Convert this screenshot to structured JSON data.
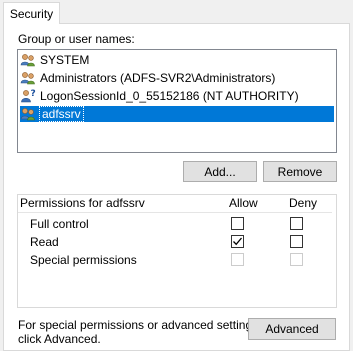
{
  "tab": {
    "label": "Security"
  },
  "group_section": {
    "label": "Group or user names:",
    "items": [
      {
        "name": "SYSTEM",
        "icon": "users-group-icon",
        "selected": false
      },
      {
        "name": "Administrators (ADFS-SVR2\\Administrators)",
        "icon": "users-group-icon",
        "selected": false
      },
      {
        "name": "LogonSessionId_0_55152186 (NT AUTHORITY)",
        "icon": "unknown-user-icon",
        "selected": false
      },
      {
        "name": "adfssrv",
        "icon": "users-group-icon",
        "selected": true
      }
    ],
    "add_button": "Add...",
    "remove_button": "Remove"
  },
  "permissions": {
    "title": "Permissions for adfssrv",
    "allow_header": "Allow",
    "deny_header": "Deny",
    "rows": [
      {
        "name": "Full control",
        "allow": false,
        "deny": false,
        "enabled": true
      },
      {
        "name": "Read",
        "allow": true,
        "deny": false,
        "enabled": true
      },
      {
        "name": "Special permissions",
        "allow": false,
        "deny": false,
        "enabled": false
      }
    ]
  },
  "advanced": {
    "text_line1": "For special permissions or advanced settings,",
    "text_line2": "click Advanced.",
    "button": "Advanced"
  },
  "colors": {
    "selection": "#0078d7",
    "window_bg": "#f0f0f0",
    "button_bg": "#e1e1e1"
  }
}
